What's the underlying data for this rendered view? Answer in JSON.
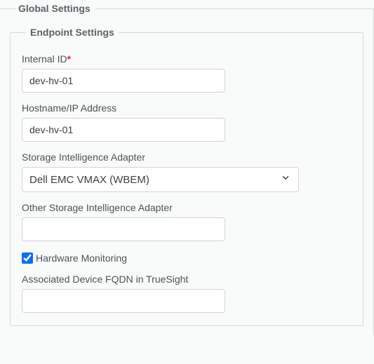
{
  "global": {
    "legend": "Global Settings"
  },
  "endpoint": {
    "legend": "Endpoint Settings",
    "internal_id": {
      "label": "Internal ID",
      "required_marker": "*",
      "value": "dev-hv-01"
    },
    "hostname": {
      "label": "Hostname/IP Address",
      "value": "dev-hv-01"
    },
    "adapter": {
      "label": "Storage Intelligence Adapter",
      "value": "Dell EMC VMAX (WBEM)"
    },
    "other_adapter": {
      "label": "Other Storage Intelligence Adapter",
      "value": ""
    },
    "hardware_monitoring": {
      "label": "Hardware Monitoring",
      "checked": true
    },
    "associated_fqdn": {
      "label": "Associated Device FQDN in TrueSight",
      "value": ""
    }
  }
}
